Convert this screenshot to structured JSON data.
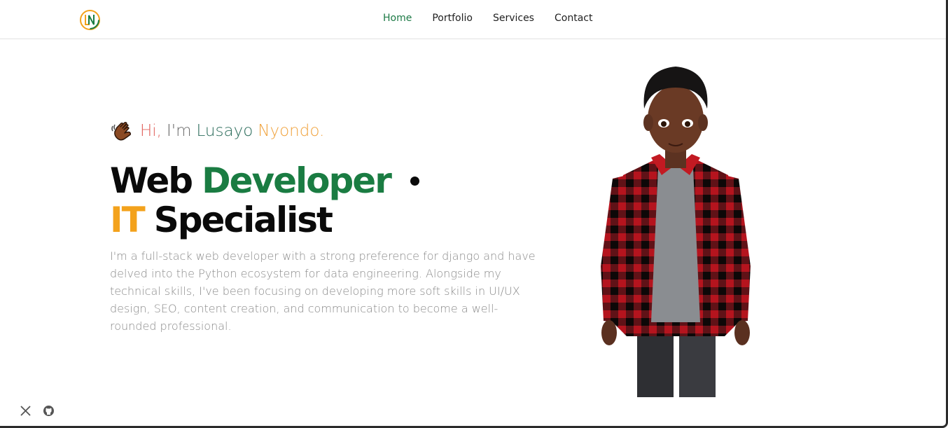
{
  "header": {
    "logo_alt": "LN",
    "nav": [
      {
        "label": "Home",
        "active": true
      },
      {
        "label": "Portfolio",
        "active": false
      },
      {
        "label": "Services",
        "active": false
      },
      {
        "label": "Contact",
        "active": false
      }
    ]
  },
  "hero": {
    "greeting": {
      "icon": "waving-hand-icon",
      "hi": "Hi,",
      "im": "I'm",
      "first_name": "Lusayo",
      "last_name": "Nyondo."
    },
    "title_line1": {
      "word1": "Web",
      "word2": "Developer"
    },
    "title_line2": {
      "word1": "IT",
      "word2": "Specialist"
    },
    "description": "I'm a full-stack web developer with a strong preference for django and have delved into the Python ecosystem for data engineering. Alongside my technical skills, I've been focusing on developing more soft skills in UI/UX design, SEO, content creation, and communication to become a well-rounded professional."
  },
  "social": [
    {
      "icon": "x-twitter-icon"
    },
    {
      "icon": "github-icon"
    }
  ],
  "colors": {
    "accent_green": "#1a7c42",
    "accent_orange": "#f3a21c",
    "accent_red": "#e0605a",
    "nav_active": "#1d7a46"
  }
}
